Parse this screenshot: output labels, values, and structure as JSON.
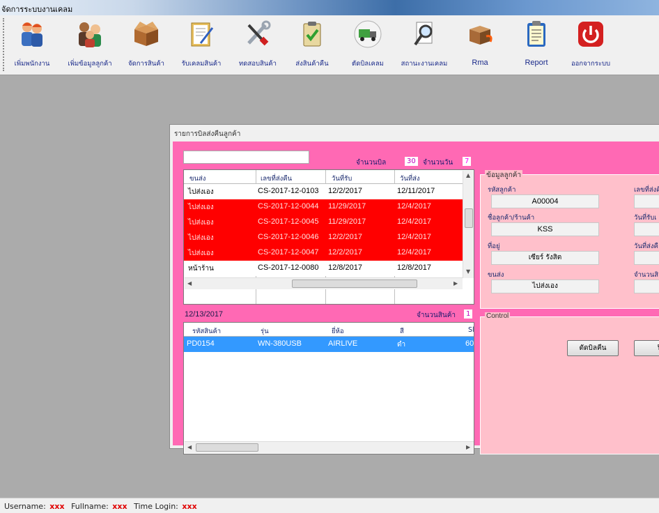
{
  "app": {
    "title": "จัดการระบบงานเคลม",
    "toolbar": [
      {
        "label": "เพิ่มพนักงาน",
        "icon": "employees-icon"
      },
      {
        "label": "เพิ่มข้อมูลลูกค้า",
        "icon": "customers-icon"
      },
      {
        "label": "จัดการสินค้า",
        "icon": "product-box-icon"
      },
      {
        "label": "รับเคลมสินค้า",
        "icon": "receive-claim-icon"
      },
      {
        "label": "ทดสอบสินค้า",
        "icon": "tools-icon"
      },
      {
        "label": "ส่งสินค้าคืน",
        "icon": "checklist-icon"
      },
      {
        "label": "ตัดบิลเคลม",
        "icon": "delivery-truck-icon"
      },
      {
        "label": "สถานะงานเคลม",
        "icon": "magnifier-icon"
      },
      {
        "label": "Rma",
        "icon": "rma-box-icon"
      },
      {
        "label": "Report",
        "icon": "report-clipboard-icon"
      },
      {
        "label": "ออกจากระบบ",
        "icon": "power-icon"
      }
    ]
  },
  "window": {
    "title": "รายการบิลส่งคืนลูกค้า",
    "search_value": "",
    "bill_count_label": "จำนวนบิล",
    "bill_count": "30",
    "day_count_label": "จำนวนวัน",
    "day_count": "7",
    "bills": {
      "columns": [
        "ขนส่ง",
        "เลขที่ส่งคืน",
        "วันที่รับ",
        "วันที่ส่ง"
      ],
      "rows": [
        {
          "transport": "ไปส่งเอง",
          "return_no": "CS-2017-12-0103",
          "received": "12/2/2017",
          "sent": "12/11/2017",
          "status": "normal"
        },
        {
          "transport": "ไปส่งเอง",
          "return_no": "CS-2017-12-0044",
          "received": "11/29/2017",
          "sent": "12/4/2017",
          "status": "overdue"
        },
        {
          "transport": "ไปส่งเอง",
          "return_no": "CS-2017-12-0045",
          "received": "11/29/2017",
          "sent": "12/4/2017",
          "status": "overdue"
        },
        {
          "transport": "ไปส่งเอง",
          "return_no": "CS-2017-12-0046",
          "received": "12/2/2017",
          "sent": "12/4/2017",
          "status": "overdue"
        },
        {
          "transport": "ไปส่งเอง",
          "return_no": "CS-2017-12-0047",
          "received": "12/2/2017",
          "sent": "12/4/2017",
          "status": "overdue"
        },
        {
          "transport": "หน้าร้าน",
          "return_no": "CS-2017-12-0080",
          "received": "12/8/2017",
          "sent": "12/8/2017",
          "status": "normal"
        }
      ]
    },
    "selected_date": "12/13/2017",
    "item_count_label": "จำนวนสินค้า",
    "item_count": "1",
    "items": {
      "columns": [
        "รหัสสินค้า",
        "รุ่น",
        "ยี่ห้อ",
        "สี",
        "Sl"
      ],
      "rows": [
        {
          "code": "PD0154",
          "model": "WN-380USB",
          "brand": "AIRLIVE",
          "color": "ดำ",
          "sn": "60"
        }
      ]
    },
    "customer": {
      "group_title": "ข้อมูลลูกค้า",
      "code_label": "รหัสลูกค้า",
      "code": "A00004",
      "name_label": "ชื่อลูกค้า/ร้านค้า",
      "name": "KSS",
      "address_label": "ที่อยู่",
      "address": "เซียร์ รังสิต",
      "transport_label": "ขนส่ง",
      "transport": "ไปส่งเอง",
      "return_no_label": "เลขที่ส่งคื",
      "received_label": "วันที่รับเ",
      "sent_label": "วันที่ส่งคื",
      "qty_label": "จำนวนสิ"
    },
    "control": {
      "group_title": "Control",
      "cut_bill_label": "ตัดบิลคืน",
      "close_label": "ปิ"
    }
  },
  "status": {
    "username_label": "Username:",
    "username": "xxx",
    "fullname_label": "Fullname:",
    "fullname": "xxx",
    "login_label": "Time Login:",
    "login": "xxx"
  },
  "colors": {
    "overdue_row": "#ff0000",
    "panel_pink": "#ff69b4",
    "group_pink": "#ffc0cb",
    "selection": "#3399ff"
  }
}
